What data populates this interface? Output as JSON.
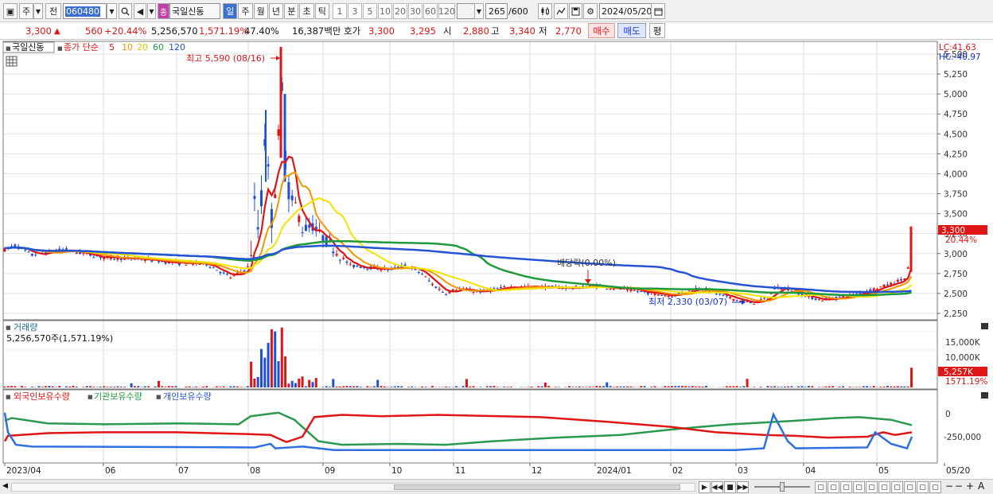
{
  "toolbar": {
    "market_label": "주",
    "prev_label": "전",
    "code_value": "060480",
    "stock_name": "국일신동",
    "stock_badge": "종",
    "period_tabs": [
      "일",
      "주",
      "월",
      "년",
      "분",
      "초",
      "틱"
    ],
    "active_period": "일",
    "interval_buttons": [
      "1",
      "3",
      "5",
      "10",
      "20",
      "30",
      "60",
      "120"
    ],
    "count_value": "265",
    "count_total": "/600",
    "date_value": "2024/05/20"
  },
  "quote": {
    "price": "3,300",
    "change": "560",
    "change_pct": "+20.44%",
    "volume": "5,256,570",
    "volume_ratio": "1,571.19%",
    "turnover": "47.40%",
    "amount": "16,387백만",
    "hoga_label": "호가",
    "ask": "3,300",
    "bid": "3,295",
    "open_label": "시",
    "open": "2,880",
    "high_label": "고",
    "high": "3,340",
    "low_label": "저",
    "low": "2,770",
    "buy_label": "매수",
    "sell_label": "매도",
    "eval_label": "평"
  },
  "price_panel": {
    "legend_name": "국일신동",
    "ma_label": "종가 단순",
    "ma_periods": [
      "5",
      "10",
      "20",
      "60",
      "120"
    ],
    "ma_colors": [
      "#e01515",
      "#f39800",
      "#f1e400",
      "#1f9a3a",
      "#2553d6"
    ],
    "lc": "LC:41.63",
    "hc": "HC:-40.97",
    "high_note": "최고 5,590 (08/16)",
    "low_note": "최저 2,330 (03/07)",
    "dividend_note": "배당락(0.00%)",
    "y_ticks": [
      "5,500",
      "5,250",
      "5,000",
      "4,750",
      "4,500",
      "4,250",
      "4,000",
      "3,750",
      "3,500",
      "3,250",
      "3,000",
      "2,750",
      "2,500",
      "2,250"
    ],
    "current_price_tag": "3,300",
    "current_pct_tag": "20.44%"
  },
  "volume_panel": {
    "title": "거래량",
    "value_line": "5,256,570주(1,571.19%)",
    "y_ticks": [
      "15,000K",
      "10,000K"
    ],
    "current_tag": "5,257K",
    "current_pct_tag": "1571.19%"
  },
  "holdings_panel": {
    "series_labels": [
      "외국인보유수량",
      "기관보유수량",
      "개인보유수량"
    ],
    "series_colors": [
      "#e01515",
      "#1f9a3a",
      "#2553d6"
    ],
    "y_ticks": [
      "0",
      "-250,000"
    ]
  },
  "x_axis": {
    "labels": [
      "2023/04",
      "06",
      "07",
      "08",
      "09",
      "10",
      "11",
      "12",
      "2024/01",
      "02",
      "03",
      "04",
      "05",
      "05/20"
    ]
  },
  "chart_data": {
    "type": "line",
    "title": "국일신동",
    "x": [
      "2023/04",
      "06",
      "07",
      "08",
      "09",
      "10",
      "11",
      "12",
      "2024/01",
      "02",
      "03",
      "04",
      "05",
      "05/20"
    ],
    "series": [
      {
        "name": "종가",
        "values": [
          3050,
          2900,
          2880,
          3300,
          3150,
          2750,
          2560,
          2580,
          2570,
          2520,
          2480,
          2450,
          2550,
          3300
        ]
      },
      {
        "name": "120",
        "values": [
          2840,
          2860,
          2880,
          2900,
          3050,
          3020,
          2950,
          2850,
          2760,
          2650,
          2580,
          2540,
          2520,
          2530
        ]
      },
      {
        "name": "외국인보유수량",
        "values": [
          -180000,
          -160000,
          -175000,
          -230000,
          20000,
          30000,
          40000,
          -20000,
          -80000,
          -180000,
          -210000,
          -250000,
          -200000,
          -150000
        ]
      }
    ],
    "ylim": [
      2200,
      5600
    ],
    "price_high": 5590,
    "price_low": 2330,
    "last_volume_k": 5257
  }
}
